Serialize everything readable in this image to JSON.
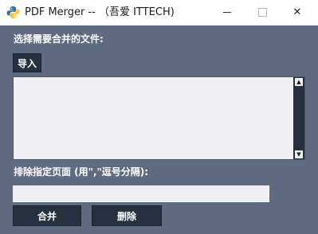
{
  "window": {
    "title": "PDF Merger -- （吾爱 ITTECH)",
    "icon": "python-icon",
    "controls": {
      "minimize": "minimize-icon",
      "maximize": "maximize-icon",
      "close": "close-icon",
      "close_glyph": "✕"
    }
  },
  "files_section": {
    "label": "选择需要合并的文件:",
    "import_button": "导入",
    "file_list": [],
    "scroll_up_glyph": "▲",
    "scroll_down_glyph": "▼"
  },
  "pages_section": {
    "label": "排除指定页面 (用\",\"逗号分隔):",
    "input_value": ""
  },
  "actions": {
    "merge_button": "合并",
    "delete_button": "删除"
  },
  "colors": {
    "background": "#5f6b81",
    "button": "#273041",
    "input": "#eeeef3",
    "text_light": "#ffffff"
  }
}
